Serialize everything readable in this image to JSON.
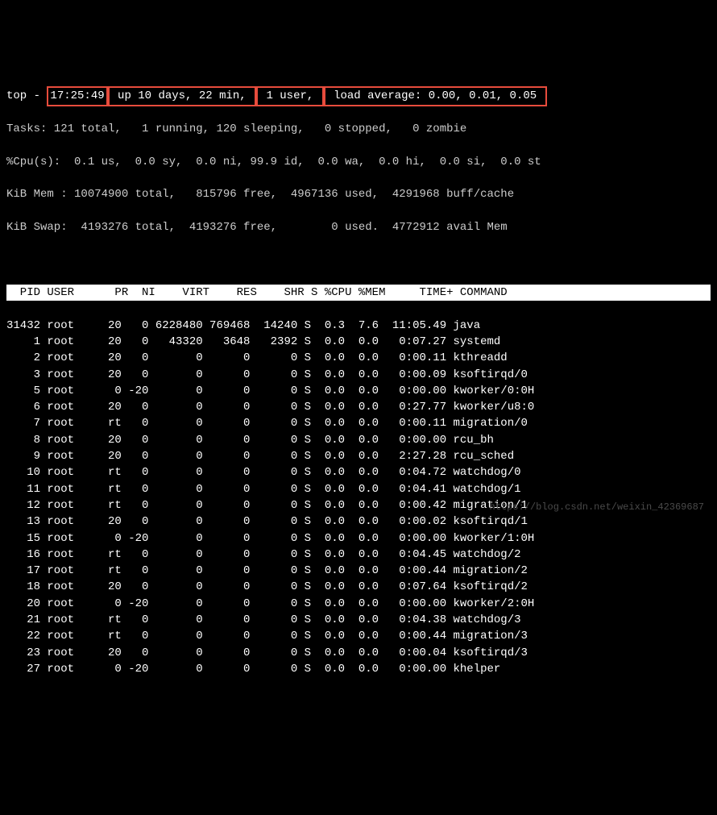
{
  "summary": {
    "prefix": "top - ",
    "time": "17:25:49",
    "uptime": " up 10 days, 22 min, ",
    "users": " 1 user, ",
    "loadavg": " load average: 0.00, 0.01, 0.05 "
  },
  "tasks_line": "Tasks: 121 total,   1 running, 120 sleeping,   0 stopped,   0 zombie",
  "cpu_line": "%Cpu(s):  0.1 us,  0.0 sy,  0.0 ni, 99.9 id,  0.0 wa,  0.0 hi,  0.0 si,  0.0 st",
  "mem_line": "KiB Mem : 10074900 total,   815796 free,  4967136 used,  4291968 buff/cache",
  "swap_line": "KiB Swap:  4193276 total,  4193276 free,        0 used.  4772912 avail Mem",
  "col_header": "  PID USER      PR  NI    VIRT    RES    SHR S %CPU %MEM     TIME+ COMMAND                         ",
  "processes": [
    {
      "pid": "31432",
      "user": "root",
      "pr": "20",
      "ni": "0",
      "virt": "6228480",
      "res": "769468",
      "shr": "14240",
      "s": "S",
      "cpu": "0.3",
      "mem": "7.6",
      "time": "11:05.49",
      "cmd": "java"
    },
    {
      "pid": "1",
      "user": "root",
      "pr": "20",
      "ni": "0",
      "virt": "43320",
      "res": "3648",
      "shr": "2392",
      "s": "S",
      "cpu": "0.0",
      "mem": "0.0",
      "time": "0:07.27",
      "cmd": "systemd"
    },
    {
      "pid": "2",
      "user": "root",
      "pr": "20",
      "ni": "0",
      "virt": "0",
      "res": "0",
      "shr": "0",
      "s": "S",
      "cpu": "0.0",
      "mem": "0.0",
      "time": "0:00.11",
      "cmd": "kthreadd"
    },
    {
      "pid": "3",
      "user": "root",
      "pr": "20",
      "ni": "0",
      "virt": "0",
      "res": "0",
      "shr": "0",
      "s": "S",
      "cpu": "0.0",
      "mem": "0.0",
      "time": "0:00.09",
      "cmd": "ksoftirqd/0"
    },
    {
      "pid": "5",
      "user": "root",
      "pr": "0",
      "ni": "-20",
      "virt": "0",
      "res": "0",
      "shr": "0",
      "s": "S",
      "cpu": "0.0",
      "mem": "0.0",
      "time": "0:00.00",
      "cmd": "kworker/0:0H"
    },
    {
      "pid": "6",
      "user": "root",
      "pr": "20",
      "ni": "0",
      "virt": "0",
      "res": "0",
      "shr": "0",
      "s": "S",
      "cpu": "0.0",
      "mem": "0.0",
      "time": "0:27.77",
      "cmd": "kworker/u8:0"
    },
    {
      "pid": "7",
      "user": "root",
      "pr": "rt",
      "ni": "0",
      "virt": "0",
      "res": "0",
      "shr": "0",
      "s": "S",
      "cpu": "0.0",
      "mem": "0.0",
      "time": "0:00.11",
      "cmd": "migration/0"
    },
    {
      "pid": "8",
      "user": "root",
      "pr": "20",
      "ni": "0",
      "virt": "0",
      "res": "0",
      "shr": "0",
      "s": "S",
      "cpu": "0.0",
      "mem": "0.0",
      "time": "0:00.00",
      "cmd": "rcu_bh"
    },
    {
      "pid": "9",
      "user": "root",
      "pr": "20",
      "ni": "0",
      "virt": "0",
      "res": "0",
      "shr": "0",
      "s": "S",
      "cpu": "0.0",
      "mem": "0.0",
      "time": "2:27.28",
      "cmd": "rcu_sched"
    },
    {
      "pid": "10",
      "user": "root",
      "pr": "rt",
      "ni": "0",
      "virt": "0",
      "res": "0",
      "shr": "0",
      "s": "S",
      "cpu": "0.0",
      "mem": "0.0",
      "time": "0:04.72",
      "cmd": "watchdog/0"
    },
    {
      "pid": "11",
      "user": "root",
      "pr": "rt",
      "ni": "0",
      "virt": "0",
      "res": "0",
      "shr": "0",
      "s": "S",
      "cpu": "0.0",
      "mem": "0.0",
      "time": "0:04.41",
      "cmd": "watchdog/1"
    },
    {
      "pid": "12",
      "user": "root",
      "pr": "rt",
      "ni": "0",
      "virt": "0",
      "res": "0",
      "shr": "0",
      "s": "S",
      "cpu": "0.0",
      "mem": "0.0",
      "time": "0:00.42",
      "cmd": "migration/1"
    },
    {
      "pid": "13",
      "user": "root",
      "pr": "20",
      "ni": "0",
      "virt": "0",
      "res": "0",
      "shr": "0",
      "s": "S",
      "cpu": "0.0",
      "mem": "0.0",
      "time": "0:00.02",
      "cmd": "ksoftirqd/1"
    },
    {
      "pid": "15",
      "user": "root",
      "pr": "0",
      "ni": "-20",
      "virt": "0",
      "res": "0",
      "shr": "0",
      "s": "S",
      "cpu": "0.0",
      "mem": "0.0",
      "time": "0:00.00",
      "cmd": "kworker/1:0H"
    },
    {
      "pid": "16",
      "user": "root",
      "pr": "rt",
      "ni": "0",
      "virt": "0",
      "res": "0",
      "shr": "0",
      "s": "S",
      "cpu": "0.0",
      "mem": "0.0",
      "time": "0:04.45",
      "cmd": "watchdog/2"
    },
    {
      "pid": "17",
      "user": "root",
      "pr": "rt",
      "ni": "0",
      "virt": "0",
      "res": "0",
      "shr": "0",
      "s": "S",
      "cpu": "0.0",
      "mem": "0.0",
      "time": "0:00.44",
      "cmd": "migration/2"
    },
    {
      "pid": "18",
      "user": "root",
      "pr": "20",
      "ni": "0",
      "virt": "0",
      "res": "0",
      "shr": "0",
      "s": "S",
      "cpu": "0.0",
      "mem": "0.0",
      "time": "0:07.64",
      "cmd": "ksoftirqd/2"
    },
    {
      "pid": "20",
      "user": "root",
      "pr": "0",
      "ni": "-20",
      "virt": "0",
      "res": "0",
      "shr": "0",
      "s": "S",
      "cpu": "0.0",
      "mem": "0.0",
      "time": "0:00.00",
      "cmd": "kworker/2:0H"
    },
    {
      "pid": "21",
      "user": "root",
      "pr": "rt",
      "ni": "0",
      "virt": "0",
      "res": "0",
      "shr": "0",
      "s": "S",
      "cpu": "0.0",
      "mem": "0.0",
      "time": "0:04.38",
      "cmd": "watchdog/3"
    },
    {
      "pid": "22",
      "user": "root",
      "pr": "rt",
      "ni": "0",
      "virt": "0",
      "res": "0",
      "shr": "0",
      "s": "S",
      "cpu": "0.0",
      "mem": "0.0",
      "time": "0:00.44",
      "cmd": "migration/3"
    },
    {
      "pid": "23",
      "user": "root",
      "pr": "20",
      "ni": "0",
      "virt": "0",
      "res": "0",
      "shr": "0",
      "s": "S",
      "cpu": "0.0",
      "mem": "0.0",
      "time": "0:00.04",
      "cmd": "ksoftirqd/3"
    },
    {
      "pid": "27",
      "user": "root",
      "pr": "0",
      "ni": "-20",
      "virt": "0",
      "res": "0",
      "shr": "0",
      "s": "S",
      "cpu": "0.0",
      "mem": "0.0",
      "time": "0:00.00",
      "cmd": "khelper"
    }
  ],
  "watermark": "https://blog.csdn.net/weixin_42369687"
}
